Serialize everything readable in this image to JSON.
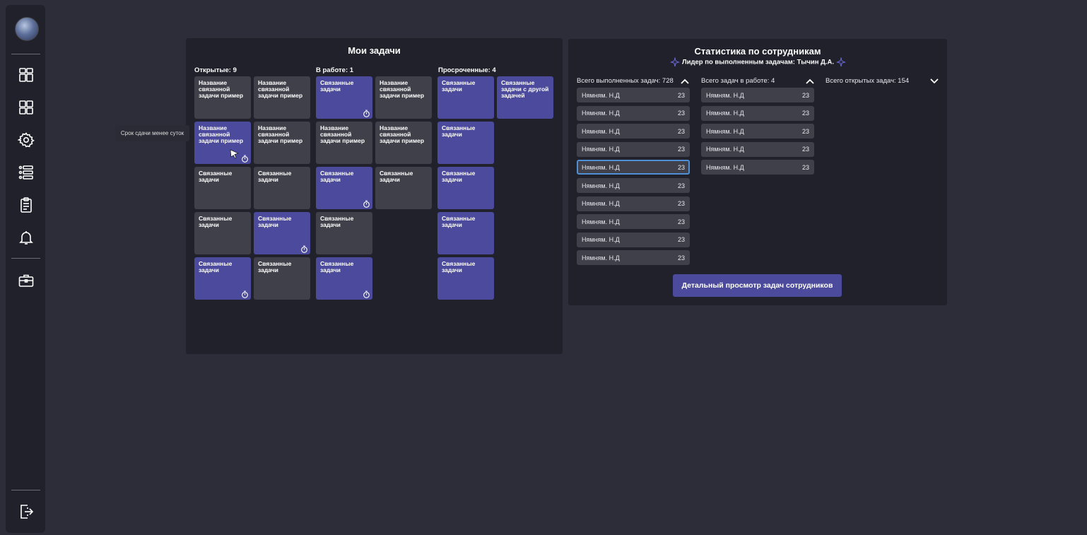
{
  "sidebar": {
    "icons": [
      "dashboard-icon",
      "grid-icon",
      "settings-icon",
      "list-icon",
      "clipboard-icon",
      "bell-icon",
      "briefcase-icon",
      "logout-icon"
    ]
  },
  "tasks": {
    "title": "Мои задачи",
    "open_label": "Открытые: 9",
    "inprogress_label": "В работе: 1",
    "overdue_label": "Просроченные: 4",
    "tooltip": "Срок сдачи менее суток",
    "cards": [
      "Название связанной задачи пример",
      "Название связанной задачи пример",
      "Связанные задачи",
      "Название связанной задачи пример",
      "Связанные задачи",
      "Связанные задачи с другой задачей",
      "Название связанной задачи пример",
      "Название связанной задачи пример",
      "Название связанной задачи пример",
      "Название связанной задачи пример",
      "Связанные задачи",
      "Связанные задачи",
      "Связанные задачи",
      "Связанные задачи",
      "Связанные задачи",
      "Связанные задачи",
      "Связанные задачи",
      "Связанные задачи",
      "Связанные задачи",
      "Связанные задачи",
      "Связанные задачи",
      "Связанные задачи",
      "Связанные задачи",
      "Связанные задачи"
    ]
  },
  "stats": {
    "title": "Статистика по сотрудникам",
    "leader": "Лидер по выполненным задачам: Тычин Д.А.",
    "completed_label": "Всего выполненных задач: 728",
    "inwork_label": "Всего задач в работе: 4",
    "open_label": "Всего открытых задач: 154",
    "employee_name": "Нямням. Н.Д",
    "employee_value": "23",
    "detail_button": "Детальный просмотр задач сотрудников"
  },
  "colors": {
    "background": "#2d2d3a",
    "panel": "#21212c",
    "card_gray": "#40404a",
    "card_purple": "#4b4a9c",
    "selected_border": "#4f8fd6"
  }
}
